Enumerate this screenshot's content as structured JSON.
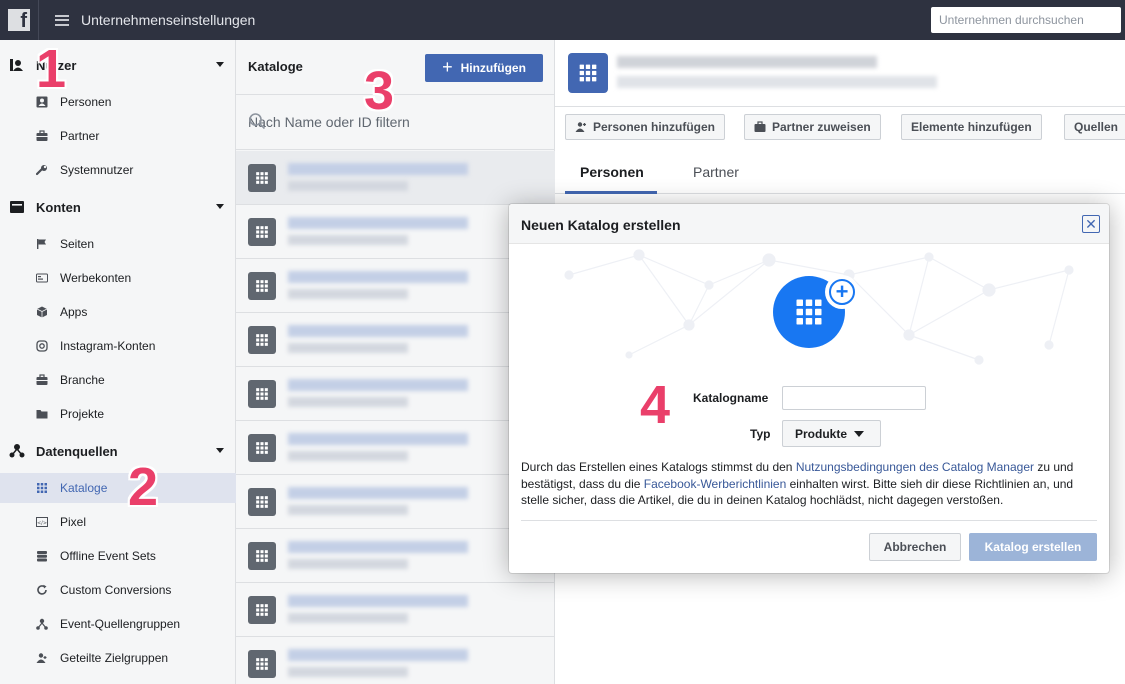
{
  "topbar": {
    "logo": "f",
    "title": "Unternehmenseinstellungen",
    "search_placeholder": "Unternehmen durchsuchen"
  },
  "sidebar": {
    "sections": [
      {
        "label": "Nutzer",
        "icon": "users-icon",
        "items": [
          {
            "label": "Personen",
            "icon": "person-card-icon"
          },
          {
            "label": "Partner",
            "icon": "briefcase-icon"
          },
          {
            "label": "Systemnutzer",
            "icon": "wrench-icon"
          }
        ]
      },
      {
        "label": "Konten",
        "icon": "inbox-icon",
        "items": [
          {
            "label": "Seiten",
            "icon": "flag-icon"
          },
          {
            "label": "Werbekonten",
            "icon": "ad-account-icon"
          },
          {
            "label": "Apps",
            "icon": "cube-icon"
          },
          {
            "label": "Instagram-Konten",
            "icon": "instagram-icon"
          },
          {
            "label": "Branche",
            "icon": "briefcase-icon"
          },
          {
            "label": "Projekte",
            "icon": "folder-icon"
          }
        ]
      },
      {
        "label": "Datenquellen",
        "icon": "data-sources-icon",
        "items": [
          {
            "label": "Kataloge",
            "icon": "grid-icon",
            "active": true
          },
          {
            "label": "Pixel",
            "icon": "pixel-icon"
          },
          {
            "label": "Offline Event Sets",
            "icon": "database-icon"
          },
          {
            "label": "Custom Conversions",
            "icon": "refresh-icon"
          },
          {
            "label": "Event-Quellengruppen",
            "icon": "hierarchy-icon"
          },
          {
            "label": "Geteilte Zielgruppen",
            "icon": "shared-people-icon"
          }
        ]
      }
    ]
  },
  "catalogs": {
    "title": "Kataloge",
    "add_label": "Hinzufügen",
    "filter_placeholder": "Nach Name oder ID filtern",
    "row_count": 10
  },
  "detail": {
    "actions": [
      "Personen hinzufügen",
      "Partner zuweisen",
      "Elemente hinzufügen",
      "Quellen"
    ],
    "tabs": [
      "Personen",
      "Partner"
    ],
    "active_tab": "Personen"
  },
  "modal": {
    "title": "Neuen Katalog erstellen",
    "close": "✕",
    "name_label": "Katalogname",
    "name_value": "",
    "type_label": "Typ",
    "type_value": "Produkte",
    "terms_prefix": "Durch das Erstellen eines Katalogs stimmst du den ",
    "terms_link1": "Nutzungsbedingungen des Catalog Manager",
    "terms_mid": " zu und bestätigst, dass du die ",
    "terms_link2": "Facebook-Werberichtlinien",
    "terms_suffix": " einhalten wirst. Bitte sieh dir diese Richtlinien an, und stelle sicher, dass die Artikel, die du in deinen Katalog hochlädst, nicht dagegen verstoßen.",
    "cancel_label": "Abbrechen",
    "create_label": "Katalog erstellen"
  },
  "annotations": [
    "1",
    "2",
    "3",
    "4"
  ],
  "colors": {
    "accent": "#4267b2",
    "annotation": "#ea3f6a",
    "topbar": "#2e3240"
  }
}
